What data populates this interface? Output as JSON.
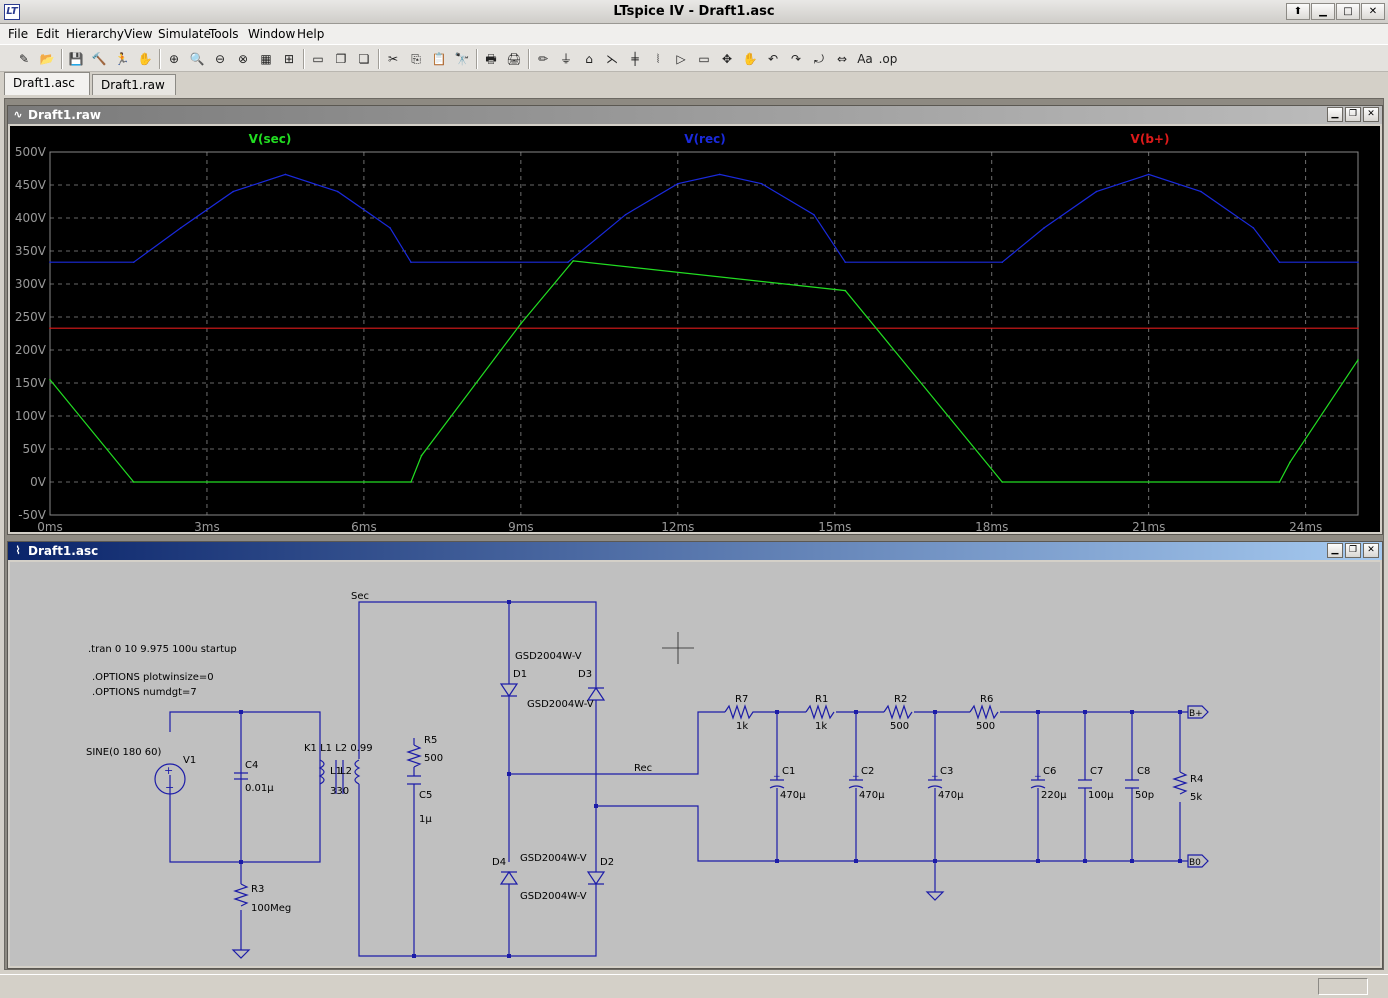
{
  "window": {
    "title": "LTspice IV - Draft1.asc",
    "logo": "LT",
    "buttons": {
      "help": "⬆",
      "minimize": "▁",
      "maximize": "□",
      "close": "✕"
    }
  },
  "menu": [
    "File",
    "Edit",
    "Hierarchy",
    "View",
    "Simulate",
    "Tools",
    "Window",
    "Help"
  ],
  "toolbar_icons": [
    "new-schematic-icon",
    "open-icon",
    "save-icon",
    "control-panel-icon",
    "run-icon",
    "halt-icon",
    "zoom-in-icon",
    "zoom-pan-icon",
    "zoom-out-icon",
    "zoom-fit-icon",
    "autorange-icon",
    "grid-icon",
    "tile-horizontal-icon",
    "cascade-icon",
    "close-all-icon",
    "cut-icon",
    "copy-icon",
    "paste-icon",
    "find-icon",
    "print-setup-icon",
    "print-icon",
    "draw-wire-icon",
    "ground-icon",
    "label-net-icon",
    "resistor-icon",
    "capacitor-icon",
    "inductor-icon",
    "diode-icon",
    "component-icon",
    "move-icon",
    "drag-icon",
    "undo-icon",
    "redo-icon",
    "rotate-icon",
    "mirror-icon",
    "text-icon",
    "spice-directive-icon"
  ],
  "toolbar_glyphs": [
    "✎",
    "📂",
    "💾",
    "🔨",
    "🏃",
    "✋",
    "⊕",
    "🔍",
    "⊖",
    "⊗",
    "▦",
    "⊞",
    "▭",
    "❐",
    "❏",
    "✂",
    "⎘",
    "📋",
    "🔭",
    "🖶",
    "🖨",
    "✏",
    "⏚",
    "⌂",
    "⋋",
    "╪",
    "⦚",
    "▷",
    "▭",
    "✥",
    "✋",
    "↶",
    "↷",
    "⤾",
    "⇔",
    "Aa",
    ".op"
  ],
  "tabs": [
    {
      "label": "Draft1.asc",
      "active": true
    },
    {
      "label": "Draft1.raw",
      "active": false
    }
  ],
  "waveform_window": {
    "title": "Draft1.raw",
    "buttons": {
      "minimize": "▁",
      "restore": "❐",
      "close": "✕"
    }
  },
  "schematic_window": {
    "title": "Draft1.asc",
    "buttons": {
      "minimize": "▁",
      "restore": "❐",
      "close": "✕"
    }
  },
  "chart_data": {
    "type": "line",
    "title": "",
    "xlabel": "",
    "ylabel": "",
    "xlim": [
      0,
      25
    ],
    "ylim": [
      -50,
      500
    ],
    "xticks": [
      "0ms",
      "3ms",
      "6ms",
      "9ms",
      "12ms",
      "15ms",
      "18ms",
      "21ms",
      "24ms"
    ],
    "xtick_values": [
      0,
      3,
      6,
      9,
      12,
      15,
      18,
      21,
      24
    ],
    "yticks": [
      "500V",
      "450V",
      "400V",
      "350V",
      "300V",
      "250V",
      "200V",
      "150V",
      "100V",
      "50V",
      "0V",
      "-50V"
    ],
    "ytick_values": [
      500,
      450,
      400,
      350,
      300,
      250,
      200,
      150,
      100,
      50,
      0,
      -50
    ],
    "grid": true,
    "background": "#000000",
    "series": [
      {
        "name": "V(sec)",
        "color": "#22dd22",
        "x": [
          0,
          1.6,
          6.9,
          7.1,
          9.0,
          10.0,
          15.2,
          18.2,
          23.5,
          23.7,
          25.0
        ],
        "y": [
          155,
          0,
          0,
          40,
          240,
          335,
          290,
          0,
          0,
          30,
          185
        ]
      },
      {
        "name": "V(rec)",
        "color": "#1a2adc",
        "x": [
          0,
          1.6,
          2.5,
          3.5,
          4.5,
          5.5,
          6.5,
          6.9,
          9.9,
          11.0,
          12.0,
          12.8,
          13.6,
          14.6,
          15.2,
          18.2,
          19.0,
          20.0,
          21.0,
          22.0,
          23.0,
          23.5,
          25.0
        ],
        "y": [
          333,
          333,
          385,
          440,
          466,
          440,
          385,
          333,
          333,
          405,
          452,
          466,
          452,
          405,
          333,
          333,
          385,
          440,
          466,
          440,
          385,
          333,
          333
        ]
      },
      {
        "name": "V(b+)",
        "color": "#dd1a1a",
        "x": [
          0,
          25
        ],
        "y": [
          233,
          233
        ]
      }
    ]
  },
  "schematic": {
    "directives": [
      ".tran 0 10 9.975 100u startup",
      ".OPTIONS plotwinsize=0",
      ".OPTIONS numdgt=7"
    ],
    "source": {
      "name": "V1",
      "value": "SINE(0 180 60)"
    },
    "coupling": "K1 L1 L2 0.99",
    "inductors": {
      "l1": "L1",
      "l2": "L2",
      "l2_value": "330"
    },
    "nets": {
      "sec": "Sec",
      "rec": "Rec",
      "bplus": "B+",
      "bzero": "B0"
    },
    "diodes": [
      {
        "ref": "D1",
        "model": "GSD2004W-V"
      },
      {
        "ref": "D3",
        "model": "GSD2004W-V"
      },
      {
        "ref": "D4",
        "model": "GSD2004W-V"
      },
      {
        "ref": "D2",
        "model": "GSD2004W-V"
      }
    ],
    "resistors": [
      {
        "ref": "R5",
        "value": "500"
      },
      {
        "ref": "R3",
        "value": "100Meg"
      },
      {
        "ref": "R7",
        "value": "1k"
      },
      {
        "ref": "R1",
        "value": "1k"
      },
      {
        "ref": "R2",
        "value": "500"
      },
      {
        "ref": "R6",
        "value": "500"
      },
      {
        "ref": "R4",
        "value": "5k"
      }
    ],
    "capacitors": [
      {
        "ref": "C4",
        "value": "0.01µ"
      },
      {
        "ref": "C5",
        "value": "1µ"
      },
      {
        "ref": "C1",
        "value": "470µ"
      },
      {
        "ref": "C2",
        "value": "470µ"
      },
      {
        "ref": "C3",
        "value": "470µ"
      },
      {
        "ref": "C6",
        "value": "220µ"
      },
      {
        "ref": "C7",
        "value": "100µ"
      },
      {
        "ref": "C8",
        "value": "50p"
      }
    ],
    "wire_color": "#1c1ca8"
  }
}
